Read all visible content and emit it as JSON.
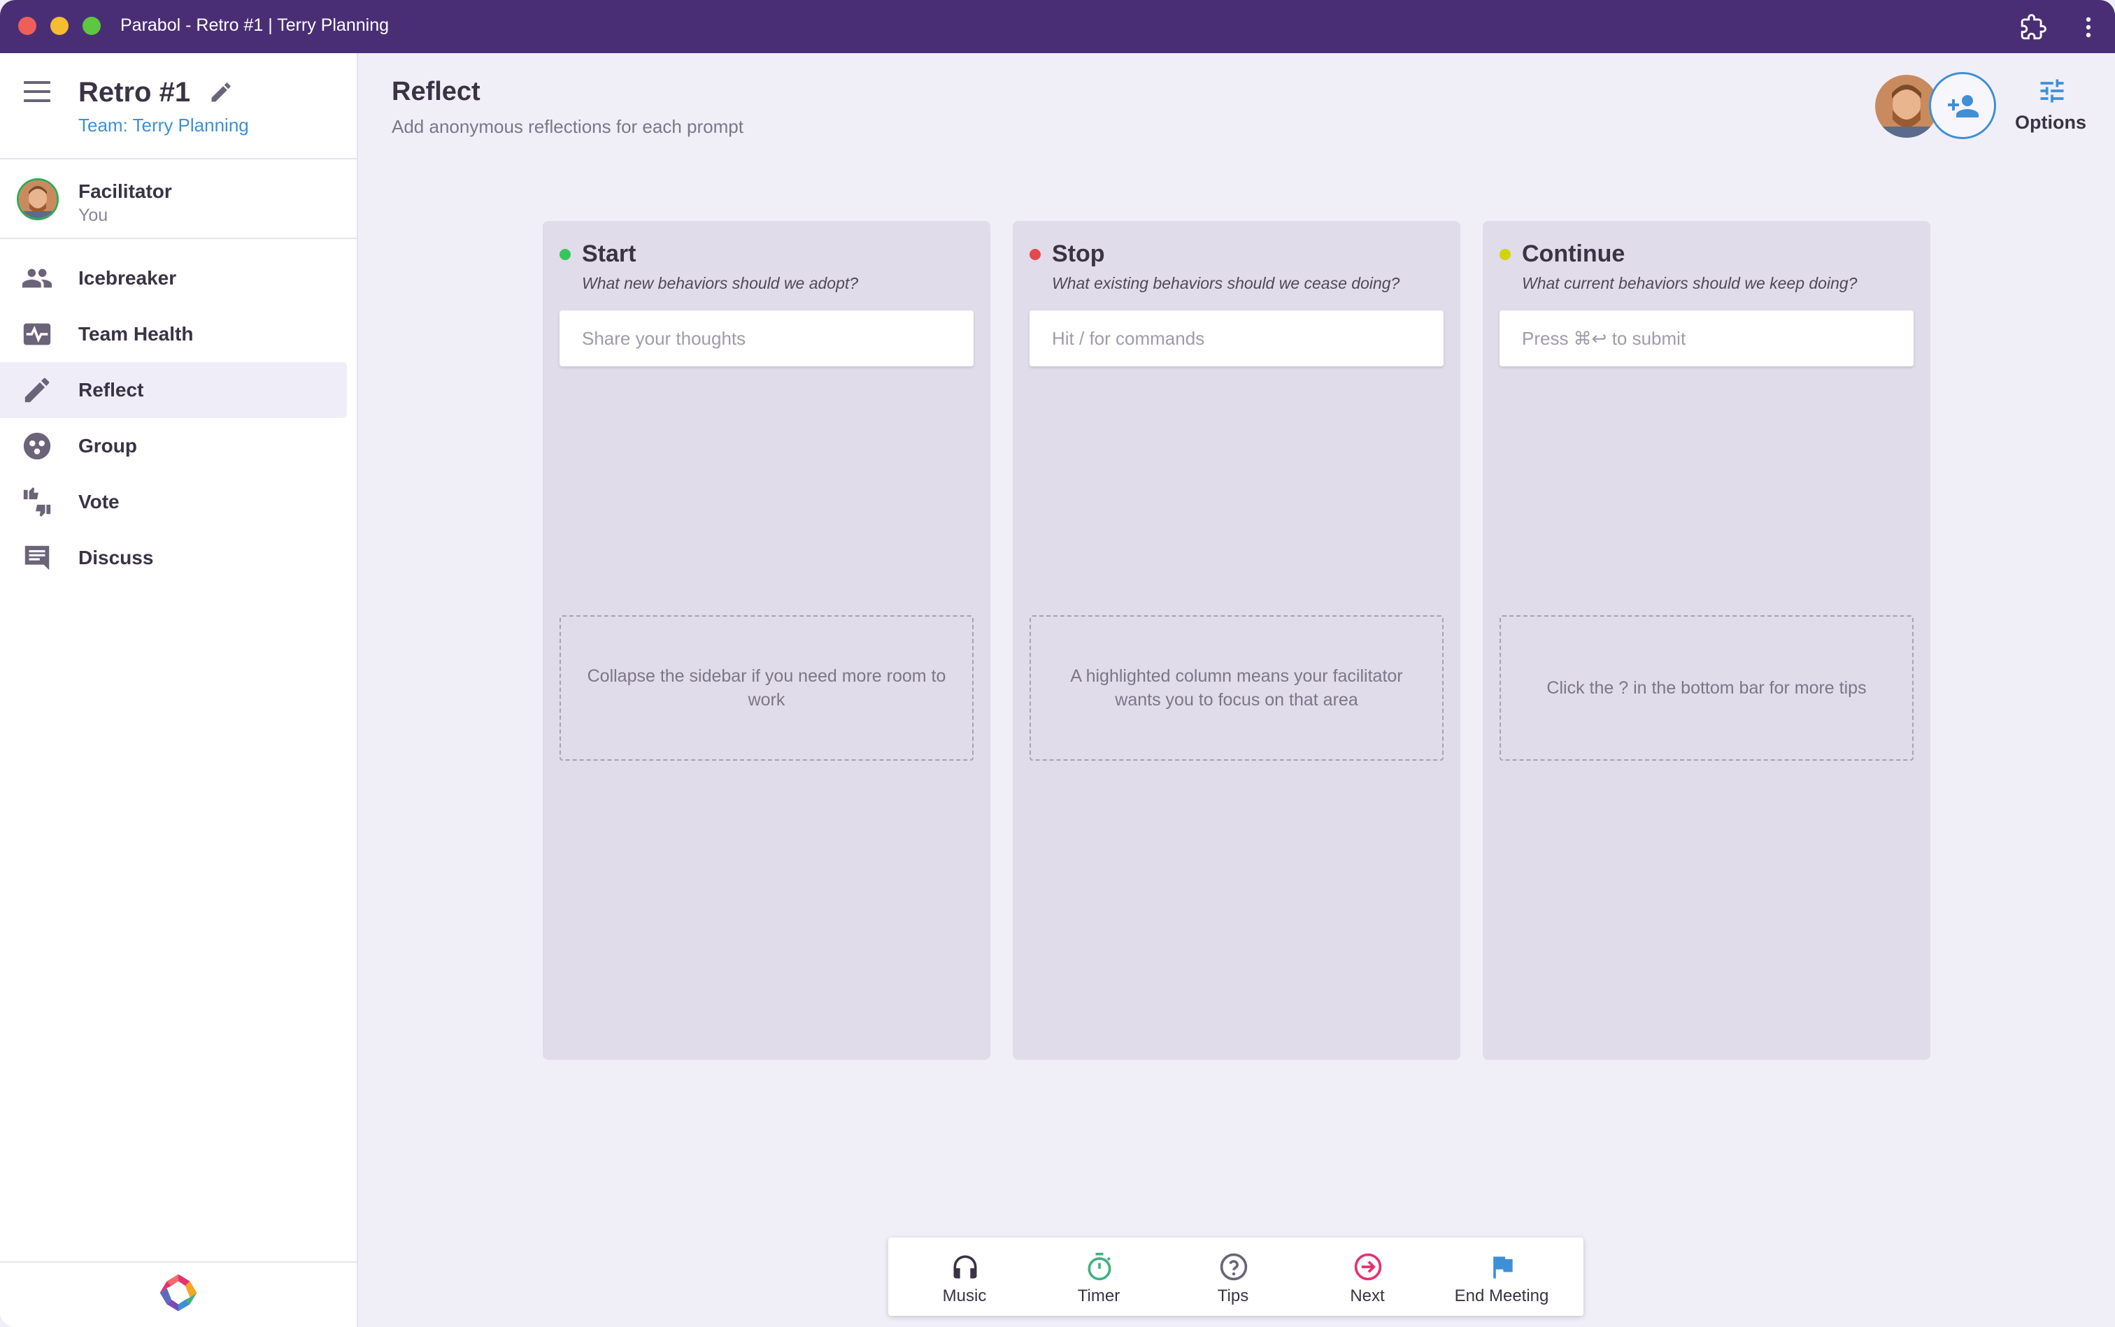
{
  "window": {
    "title": "Parabol - Retro #1 | Terry Planning"
  },
  "sidebar": {
    "meeting_name": "Retro #1",
    "team_link": "Team: Terry Planning",
    "facilitator": {
      "title": "Facilitator",
      "subtitle": "You"
    },
    "items": [
      {
        "label": "Icebreaker",
        "icon": "people-icon",
        "active": false
      },
      {
        "label": "Team Health",
        "icon": "heart-pulse-icon",
        "active": false
      },
      {
        "label": "Reflect",
        "icon": "pencil-icon",
        "active": true
      },
      {
        "label": "Group",
        "icon": "group-icon",
        "active": false
      },
      {
        "label": "Vote",
        "icon": "thumbs-icon",
        "active": false
      },
      {
        "label": "Discuss",
        "icon": "comment-icon",
        "active": false
      }
    ]
  },
  "header": {
    "title": "Reflect",
    "subtitle": "Add anonymous reflections for each prompt",
    "options_label": "Options"
  },
  "columns": [
    {
      "title": "Start",
      "description": "What new behaviors should we adopt?",
      "placeholder": "Share your thoughts",
      "tip": "Collapse the sidebar if you need more room to work",
      "dot_color": "#34c759"
    },
    {
      "title": "Stop",
      "description": "What existing behaviors should we cease doing?",
      "placeholder": "Hit / for commands",
      "tip": "A highlighted column means your facilitator wants you to focus on that area",
      "dot_color": "#e5484d"
    },
    {
      "title": "Continue",
      "description": "What current behaviors should we keep doing?",
      "placeholder": "Press ⌘↩ to submit",
      "tip": "Click the ? in the bottom bar for more tips",
      "dot_color": "#d4d400"
    }
  ],
  "bottombar": {
    "music": "Music",
    "timer": "Timer",
    "tips": "Tips",
    "next": "Next",
    "end_meeting": "End Meeting"
  },
  "colors": {
    "titlebar": "#4a2e75",
    "accent_blue": "#3d90d6",
    "next_pink": "#e5326e",
    "timer_green": "#3fb27f"
  }
}
